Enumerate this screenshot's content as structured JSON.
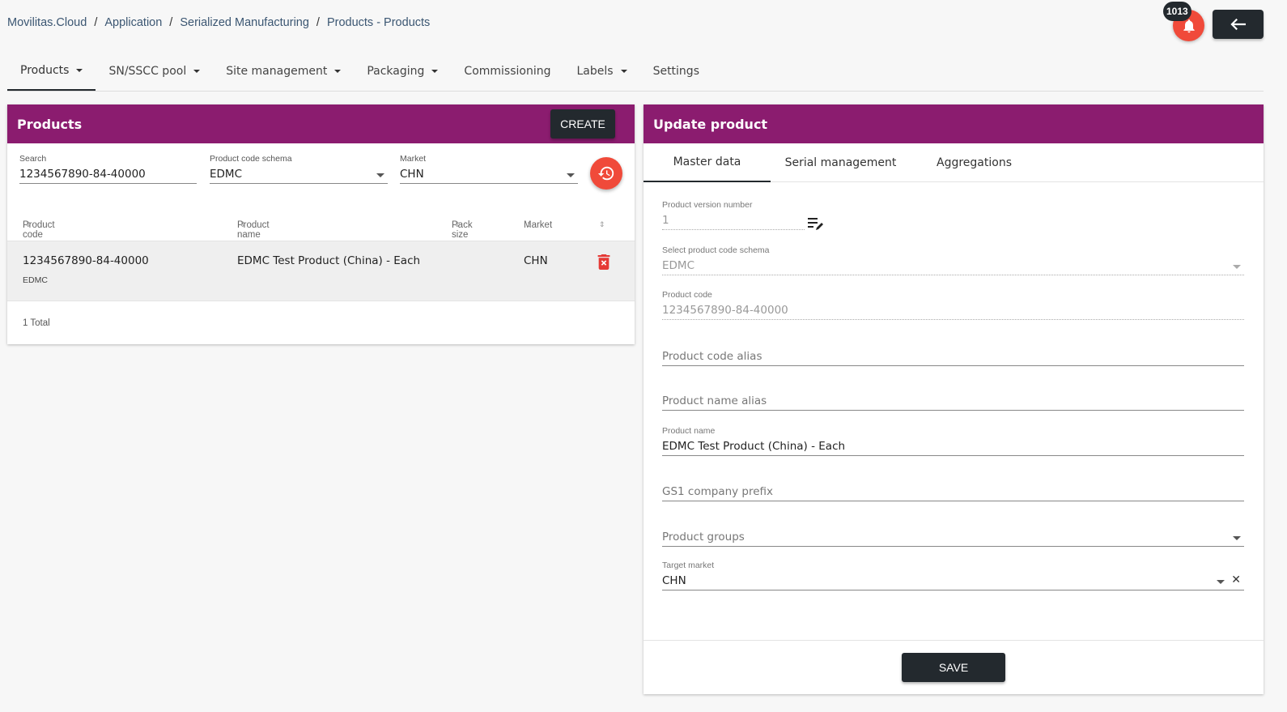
{
  "breadcrumb": {
    "items": [
      "Movilitas.Cloud",
      "Application",
      "Serialized Manufacturing",
      "Products - Products"
    ],
    "separator": "/"
  },
  "notifications": {
    "count": "1013"
  },
  "nav": {
    "items": [
      {
        "label": "Products",
        "dropdown": true
      },
      {
        "label": "SN/SSCC pool",
        "dropdown": true
      },
      {
        "label": "Site management",
        "dropdown": true
      },
      {
        "label": "Packaging",
        "dropdown": true
      },
      {
        "label": "Commissioning",
        "dropdown": false
      },
      {
        "label": "Labels",
        "dropdown": true
      },
      {
        "label": "Settings",
        "dropdown": false
      }
    ]
  },
  "products_card": {
    "title": "Products",
    "create_label": "CREATE",
    "filters": {
      "search": {
        "label": "Search",
        "value": "1234567890-84-40000"
      },
      "schema": {
        "label": "Product code schema",
        "value": "EDMC"
      },
      "market": {
        "label": "Market",
        "value": "CHN"
      }
    },
    "columns": [
      "Product code",
      "Product name",
      "Pack size",
      "Market"
    ],
    "rows": [
      {
        "code": "1234567890-84-40000",
        "schema": "EDMC",
        "name": "EDMC Test Product (China) - Each",
        "pack_size": "",
        "market": "CHN"
      }
    ],
    "total": "1 Total"
  },
  "update_card": {
    "title": "Update product",
    "tabs": [
      "Master data",
      "Serial management",
      "Aggregations"
    ],
    "fields": {
      "version": {
        "label": "Product version number",
        "value": "1"
      },
      "schema": {
        "label": "Select product code schema",
        "value": "EDMC"
      },
      "code": {
        "label": "Product code",
        "value": "1234567890-84-40000"
      },
      "code_alias": {
        "placeholder": "Product code alias"
      },
      "name_alias": {
        "placeholder": "Product name alias"
      },
      "name": {
        "label": "Product name",
        "value": "EDMC Test Product (China) - Each"
      },
      "gs1": {
        "placeholder": "GS1 company prefix"
      },
      "groups": {
        "placeholder": "Product groups"
      },
      "target_market": {
        "label": "Target market",
        "value": "CHN"
      }
    },
    "save_label": "SAVE"
  },
  "colors": {
    "header": "#8b1c6f",
    "accent_red": "#f04a3a",
    "dark_button": "#23292e"
  }
}
